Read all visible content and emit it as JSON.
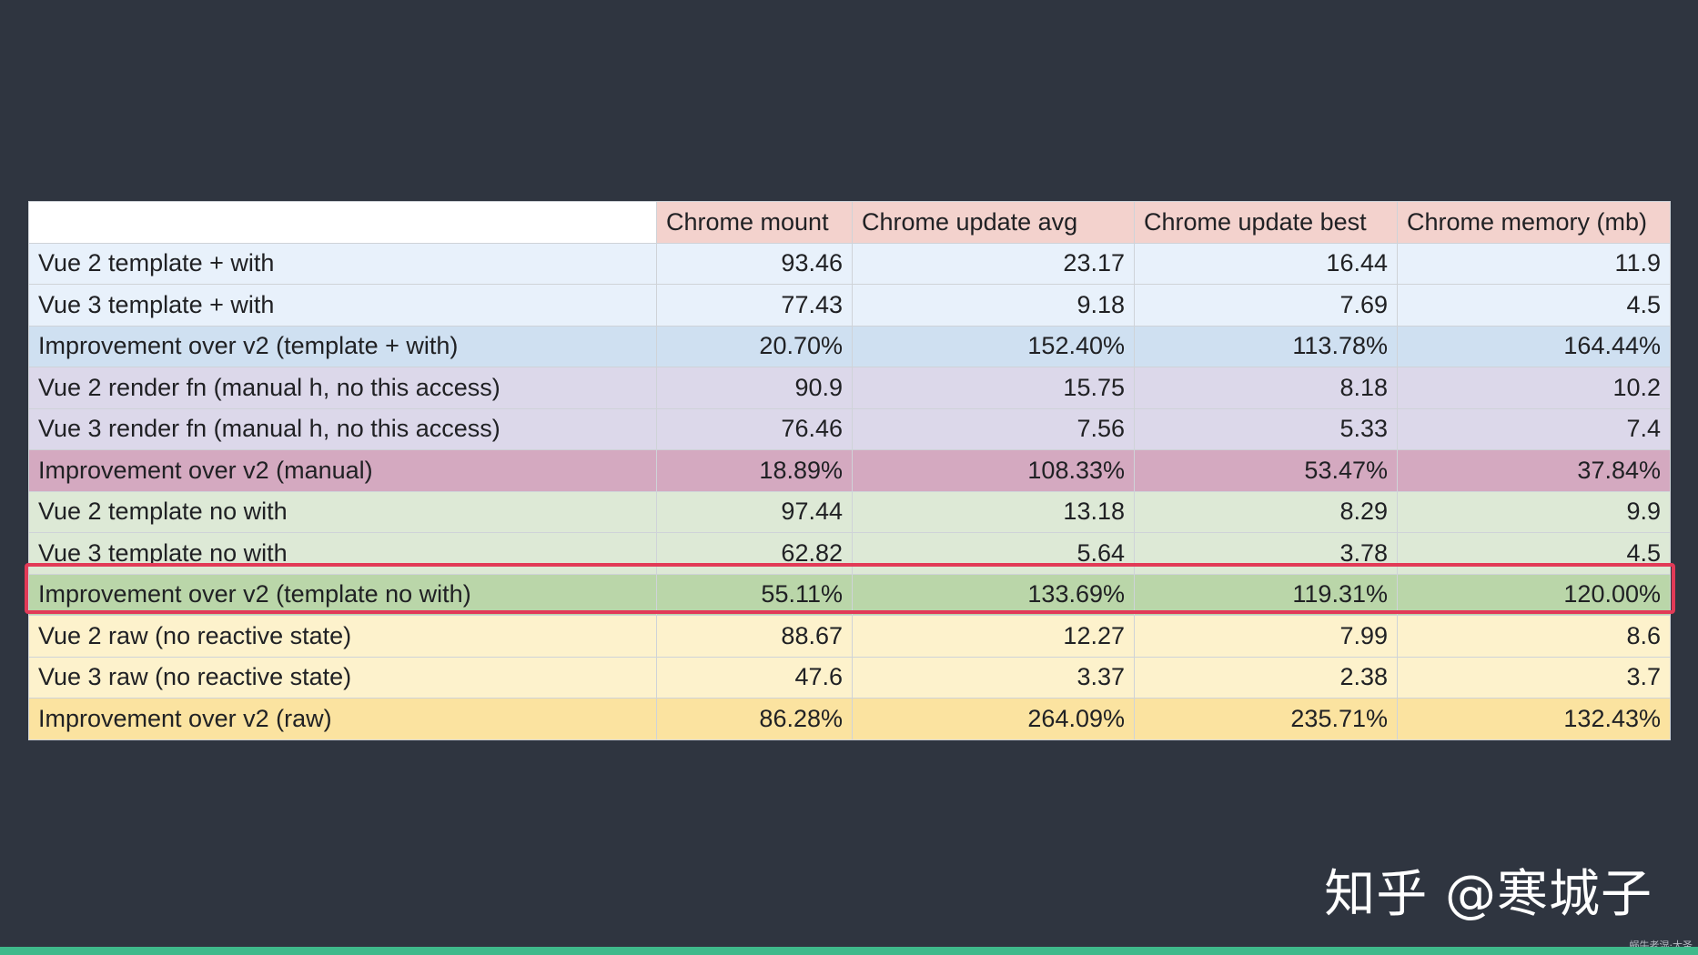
{
  "chart_data": {
    "type": "table",
    "columns": [
      "",
      "Chrome mount",
      "Chrome update avg",
      "Chrome update best",
      "Chrome memory (mb)"
    ],
    "rows": [
      {
        "label": "Vue 2 template + with",
        "values": [
          "93.46",
          "23.17",
          "16.44",
          "11.9"
        ],
        "group": "blue"
      },
      {
        "label": "Vue 3 template + with",
        "values": [
          "77.43",
          "9.18",
          "7.69",
          "4.5"
        ],
        "group": "blue"
      },
      {
        "label": "Improvement over v2 (template + with)",
        "values": [
          "20.70%",
          "152.40%",
          "113.78%",
          "164.44%"
        ],
        "group": "blue-imp"
      },
      {
        "label": "Vue 2 render fn (manual h, no this access)",
        "values": [
          "90.9",
          "15.75",
          "8.18",
          "10.2"
        ],
        "group": "purple"
      },
      {
        "label": "Vue 3 render fn (manual h, no this access)",
        "values": [
          "76.46",
          "7.56",
          "5.33",
          "7.4"
        ],
        "group": "purple"
      },
      {
        "label": "Improvement over v2 (manual)",
        "values": [
          "18.89%",
          "108.33%",
          "53.47%",
          "37.84%"
        ],
        "group": "purple-imp"
      },
      {
        "label": "Vue 2 template no with",
        "values": [
          "97.44",
          "13.18",
          "8.29",
          "9.9"
        ],
        "group": "green"
      },
      {
        "label": "Vue 3 template no with",
        "values": [
          "62.82",
          "5.64",
          "3.78",
          "4.5"
        ],
        "group": "green"
      },
      {
        "label": "Improvement over v2 (template no with)",
        "values": [
          "55.11%",
          "133.69%",
          "119.31%",
          "120.00%"
        ],
        "group": "green-imp",
        "highlighted": true
      },
      {
        "label": "Vue 2 raw (no reactive state)",
        "values": [
          "88.67",
          "12.27",
          "7.99",
          "8.6"
        ],
        "group": "yellow"
      },
      {
        "label": "Vue 3 raw (no reactive state)",
        "values": [
          "47.6",
          "3.37",
          "2.38",
          "3.7"
        ],
        "group": "yellow"
      },
      {
        "label": "Improvement over v2 (raw)",
        "values": [
          "86.28%",
          "264.09%",
          "235.71%",
          "132.43%"
        ],
        "group": "yellow-imp"
      }
    ],
    "highlight_color": "#e23a57"
  },
  "colors": {
    "background": "#2f3540",
    "header": "#f3d2cd",
    "blue": "#e8f1fb",
    "blue-imp": "#cfe0f1",
    "purple": "#dcd8ea",
    "purple-imp": "#d4a9c0",
    "green": "#dde9d6",
    "green-imp": "#bad6a9",
    "yellow": "#fdf2cc",
    "yellow-imp": "#fbe3a0",
    "bottom_bar": "#3fb98b"
  },
  "watermark": "知乎 @寒城子",
  "mini_credit": "蜗牛老湿·大圣"
}
